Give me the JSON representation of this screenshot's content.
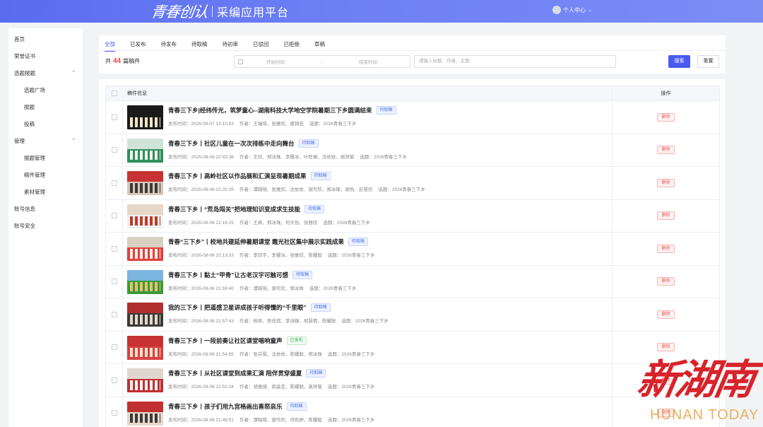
{
  "header": {
    "logo_text": "青春创认",
    "platform_title": "采编应用平台",
    "user_label": "个人中心"
  },
  "sidebar": {
    "items": [
      {
        "label": "首页",
        "level": 1
      },
      {
        "label": "荣誉证书",
        "level": 1
      },
      {
        "label": "选题报题",
        "level": 1,
        "expanded": true
      },
      {
        "label": "选题广场",
        "level": 2
      },
      {
        "label": "报题",
        "level": 2
      },
      {
        "label": "投稿",
        "level": 2
      },
      {
        "label": "管理",
        "level": 1,
        "expanded": true
      },
      {
        "label": "报题管理",
        "level": 2
      },
      {
        "label": "稿件管理",
        "level": 2
      },
      {
        "label": "素材管理",
        "level": 2
      },
      {
        "label": "账号信息",
        "level": 1
      },
      {
        "label": "账号安全",
        "level": 1
      }
    ]
  },
  "tabs": [
    "全部",
    "已发布",
    "待发布",
    "待取稿",
    "待初审",
    "已驳回",
    "已拒绝",
    "草稿"
  ],
  "active_tab": "全部",
  "filter": {
    "count_prefix": "共",
    "count": "44",
    "count_suffix": "篇稿件",
    "start_placeholder": "开始时间",
    "end_placeholder": "结束时间",
    "range_separator": "-",
    "search_placeholder": "请输入标题、作者、主题",
    "search_button": "搜索",
    "reset_button": "重置"
  },
  "table": {
    "col_info": "稿件信息",
    "col_action": "操作",
    "delete_label": "删除",
    "rows": [
      {
        "title": "青春三下乡|经纬传光，筑梦童心--湖南科技大学地空学院暑期三下乡圆满结束",
        "status": "待取稿",
        "publish_time": "发布时间：2026-08-07 13:10:53",
        "authors": "作者：王瑞琦、张雅欣、唐锦宏",
        "topic": "选题：2026青春三下乡"
      },
      {
        "title": "青春三下乡丨社区儿童在一次次排练中走向舞台",
        "status": "待取稿",
        "publish_time": "发布时间：2026-08-06 22:43:36",
        "authors": "作者：王欣、郑冰珠、李樱冰、叶旺琳、沈依依、敦祥菊",
        "topic": "选题：2026青春三下乡"
      },
      {
        "title": "青春三下乡丨高岭社区以作品展和汇演呈现暑期成果",
        "status": "待取稿",
        "publish_time": "发布时间：2026-08-06 22:20:25",
        "authors": "作者：谭晓晓、张雅欣、沈依依、谢可欣、郑冰珠、谢怡、彭慧欣",
        "topic": "选题：2026青春三下乡"
      },
      {
        "title": "青春三下乡丨“荒岛闯关”把地理知识变成求生技能",
        "status": "待取稿",
        "publish_time": "发布时间：2026-08-06 22:16:25",
        "authors": "作者：王希、郑冰珠、何天怡、张雅欣",
        "topic": "选题：2026青春三下乡"
      },
      {
        "title": "青春“三下乡”丨校地共建延伸暑期课堂 霞光社区集中展示实践成果",
        "status": "待取稿",
        "publish_time": "发布时间：2026-08-06 22:13:53",
        "authors": "作者：李欣宇、李樱冰、张雅欣、陈耀聪",
        "topic": "选题：2026青春三下乡"
      },
      {
        "title": "青春三下乡丨黏土“甲骨”让古老汉字可触可感",
        "status": "待取稿",
        "publish_time": "发布时间：2026-08-06 21:59:40",
        "authors": "作者：谭晓晓、谢可欣、郑冰珠",
        "topic": "选题：2026青春三下乡"
      },
      {
        "title": "我的三下乡丨把遥感卫星讲成孩子听得懂的“千里眼”",
        "status": "待取稿",
        "publish_time": "发布时间：2026-08-06 21:57:43",
        "authors": "作者：杨笑、吴佳琪、李诗婕、胡慧倩、陈耀聪",
        "topic": "选题：2026青春三下乡"
      },
      {
        "title": "青春三下乡丨一段前奏让社区课堂唱响童声",
        "status": "已发布",
        "publish_time": "发布时间：2026-08-06 21:54:55",
        "authors": "作者：张芬慧、沈依依、陈耀聪、郑冰珠",
        "topic": "选题：2026青春三下乡"
      },
      {
        "title": "青春三下乡丨从社区课堂到成果汇演 陪伴贯穿盛夏",
        "status": "待取稿",
        "publish_time": "发布时间：2026-08-06 21:52:04",
        "authors": "作者：胡雅捷、郭晶莹、陈耀聪、敦祥菊",
        "topic": "选题：2026青春三下乡"
      },
      {
        "title": "青春三下乡丨孩子们用九宫格画出喜怒哀乐",
        "status": "待取稿",
        "publish_time": "发布时间：2026-08-06 21:49:51",
        "authors": "作者：谭晓晓、谢可欣、邓凯婷、陈耀聪",
        "topic": "选题：2026青春三下乡"
      }
    ]
  },
  "watermark": {
    "cn": "新湖南",
    "en": "HUNAN TODAY"
  },
  "colors": {
    "primary": "#4a5af0",
    "danger": "#ea5b5b",
    "watermark_red": "#d8232a",
    "watermark_gold": "#e8b060"
  }
}
